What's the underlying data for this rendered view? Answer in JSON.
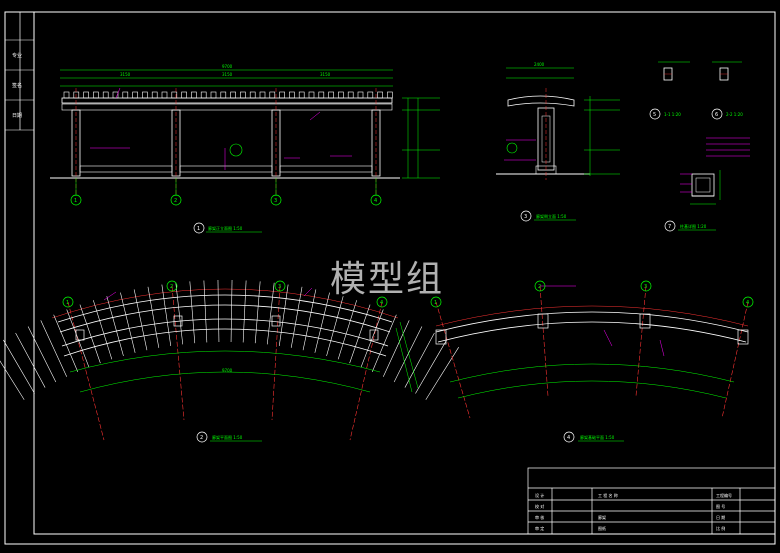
{
  "watermark": "模型组",
  "title_block": {
    "company": "工 程 名 称",
    "drawing_name": "廊架",
    "sheet": "图纸",
    "left_labels": [
      "设 计",
      "校 对",
      "审 核",
      "审 定"
    ],
    "right_labels": [
      "工程编号",
      "图 号",
      "日 期",
      "比 例"
    ]
  },
  "left_strip": [
    "专业",
    "签名",
    "日期"
  ],
  "views": {
    "front_elevation": {
      "number": "1",
      "caption": "廊架正立面图 1:50"
    },
    "plan": {
      "number": "2",
      "caption": "廊架平面图 1:50"
    },
    "side_elevation": {
      "number": "3",
      "caption": "廊架侧立面 1:50"
    },
    "foundation_plan": {
      "number": "4",
      "caption": "廊架基础平面 1:50"
    },
    "detail_5": {
      "number": "5",
      "caption": "1-1 1:20"
    },
    "detail_6": {
      "number": "6",
      "caption": "2-2 1:20"
    },
    "column_detail": {
      "number": "7",
      "caption": "柱基详图 1:20"
    }
  },
  "axes": [
    "1",
    "2",
    "3",
    "4"
  ],
  "dimensions": {
    "front_total": "9700",
    "front_bays": [
      "3150",
      "3150",
      "3150"
    ],
    "side_total": "2400",
    "plan_total": "9700"
  }
}
